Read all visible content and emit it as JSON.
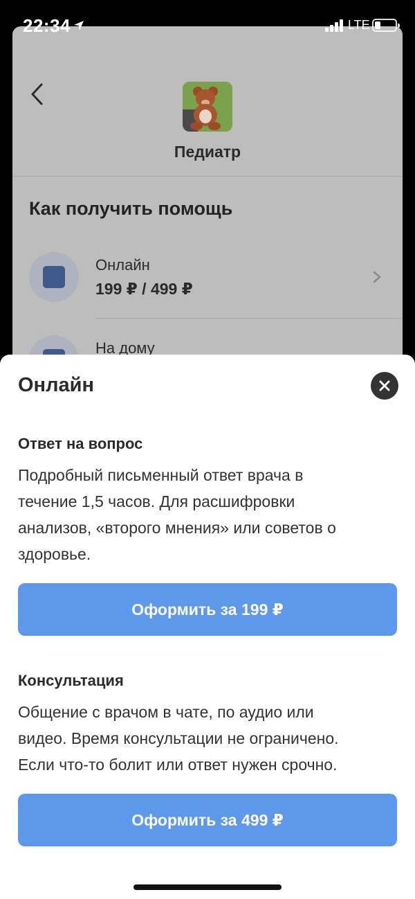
{
  "status_bar": {
    "time": "22:34",
    "network": "LTE"
  },
  "header": {
    "title": "Педиатр"
  },
  "background_page": {
    "section_title": "Как получить помощь",
    "options": [
      {
        "title": "Онлайн",
        "price": "199 ₽ / 499 ₽"
      },
      {
        "title": "На дому"
      }
    ]
  },
  "sheet": {
    "title": "Онлайн",
    "sections": [
      {
        "title": "Ответ на вопрос",
        "lines": [
          "Подробный письменный ответ врача в",
          "течение 1,5 часов. Для расшифровки",
          "анализов, «второго мнения» или советов о",
          "здоровье."
        ],
        "button": "Оформить за 199 ₽"
      },
      {
        "title": "Консультация",
        "lines": [
          "Общение с врачом в чате, по аудио или",
          "видео. Время консультации не ограничено.",
          "Если что-то болит или ответ нужен срочно."
        ],
        "button": "Оформить за 499 ₽"
      }
    ]
  },
  "colors": {
    "accent": "#5e98ea",
    "overlay": "#bdbdbd",
    "close": "#333333"
  }
}
